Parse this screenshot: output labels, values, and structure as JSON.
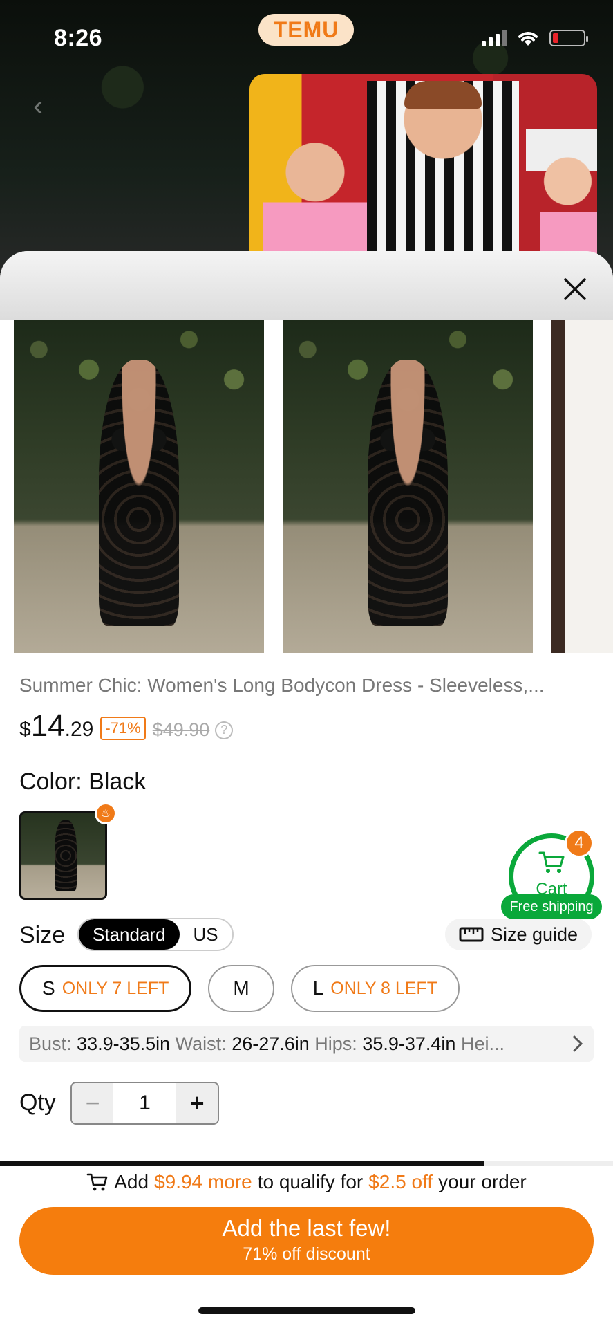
{
  "status_bar": {
    "time": "8:26",
    "app_badge": "TEMU"
  },
  "product": {
    "title": "Summer Chic: Women's Long Bodycon Dress - Sleeveless,...",
    "price_currency": "$",
    "price_integer": "14",
    "price_decimal": ".29",
    "discount": "-71%",
    "original_price": "$49.90"
  },
  "color": {
    "label": "Color: Black"
  },
  "cart": {
    "label": "Cart",
    "count": "4",
    "free_shipping": "Free shipping"
  },
  "size": {
    "label": "Size",
    "toggle": [
      "Standard",
      "US"
    ],
    "guide_label": "Size guide",
    "options": [
      {
        "size": "S",
        "note": "ONLY 7 LEFT",
        "selected": true
      },
      {
        "size": "M",
        "note": "",
        "selected": false
      },
      {
        "size": "L",
        "note": "ONLY 8 LEFT",
        "selected": false
      }
    ],
    "measurements": {
      "bust_key": "Bust:",
      "bust_val": "33.9-35.5in",
      "waist_key": "Waist:",
      "waist_val": "26-27.6in",
      "hips_key": "Hips:",
      "hips_val": "35.9-37.4in",
      "height_key": "Hei..."
    }
  },
  "quantity": {
    "label": "Qty",
    "value": "1"
  },
  "promo": {
    "prefix": "Add",
    "amount_more": "$9.94 more",
    "middle": "to qualify for",
    "amount_off": "$2.5 off",
    "suffix": "your order",
    "progress": 0.79
  },
  "cta": {
    "main": "Add the last few!",
    "sub": "71% off discount"
  },
  "colors": {
    "accent": "#f57d0d",
    "green": "#0aa83a"
  }
}
